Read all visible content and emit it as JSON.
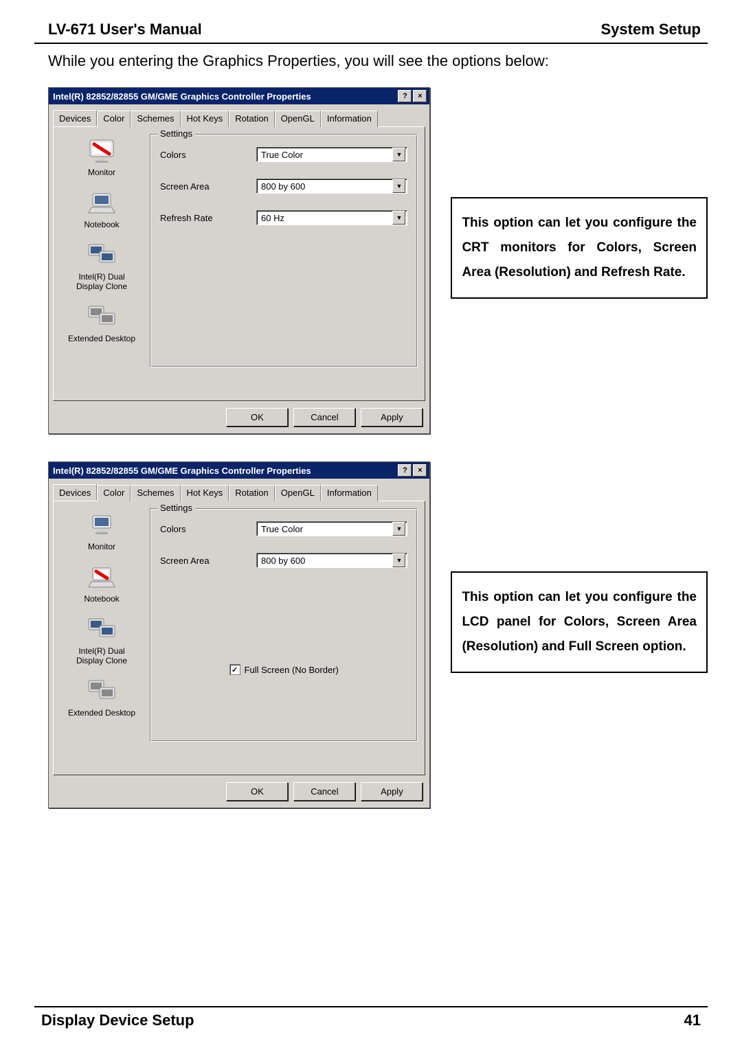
{
  "header": {
    "left": "LV-671 User's Manual",
    "right": "System Setup"
  },
  "intro": "While you entering the Graphics Properties, you will see the options below:",
  "dialog_title": "Intel(R) 82852/82855 GM/GME Graphics Controller Properties",
  "winbuttons": {
    "help": "?",
    "close": "×"
  },
  "tabs": [
    "Devices",
    "Color",
    "Schemes",
    "Hot Keys",
    "Rotation",
    "OpenGL",
    "Information"
  ],
  "devices": {
    "monitor": "Monitor",
    "notebook": "Notebook",
    "dual": "Intel(R) Dual\nDisplay Clone",
    "extended": "Extended Desktop"
  },
  "settings_legend": "Settings",
  "labels": {
    "colors": "Colors",
    "screen_area": "Screen Area",
    "refresh_rate": "Refresh Rate",
    "fullscreen": "Full Screen (No Border)"
  },
  "values": {
    "colors": "True Color",
    "screen_area": "800 by 600",
    "refresh_rate": "60 Hz"
  },
  "buttons": {
    "ok": "OK",
    "cancel": "Cancel",
    "apply": "Apply"
  },
  "callout1": "This option can let you configure the CRT monitors for Colors, Screen Area (Resolution) and Refresh Rate.",
  "callout2": "This option can let you configure the LCD panel for Colors, Screen Area (Resolution) and Full Screen option.",
  "footer": {
    "left": "Display Device Setup",
    "right": "41"
  }
}
